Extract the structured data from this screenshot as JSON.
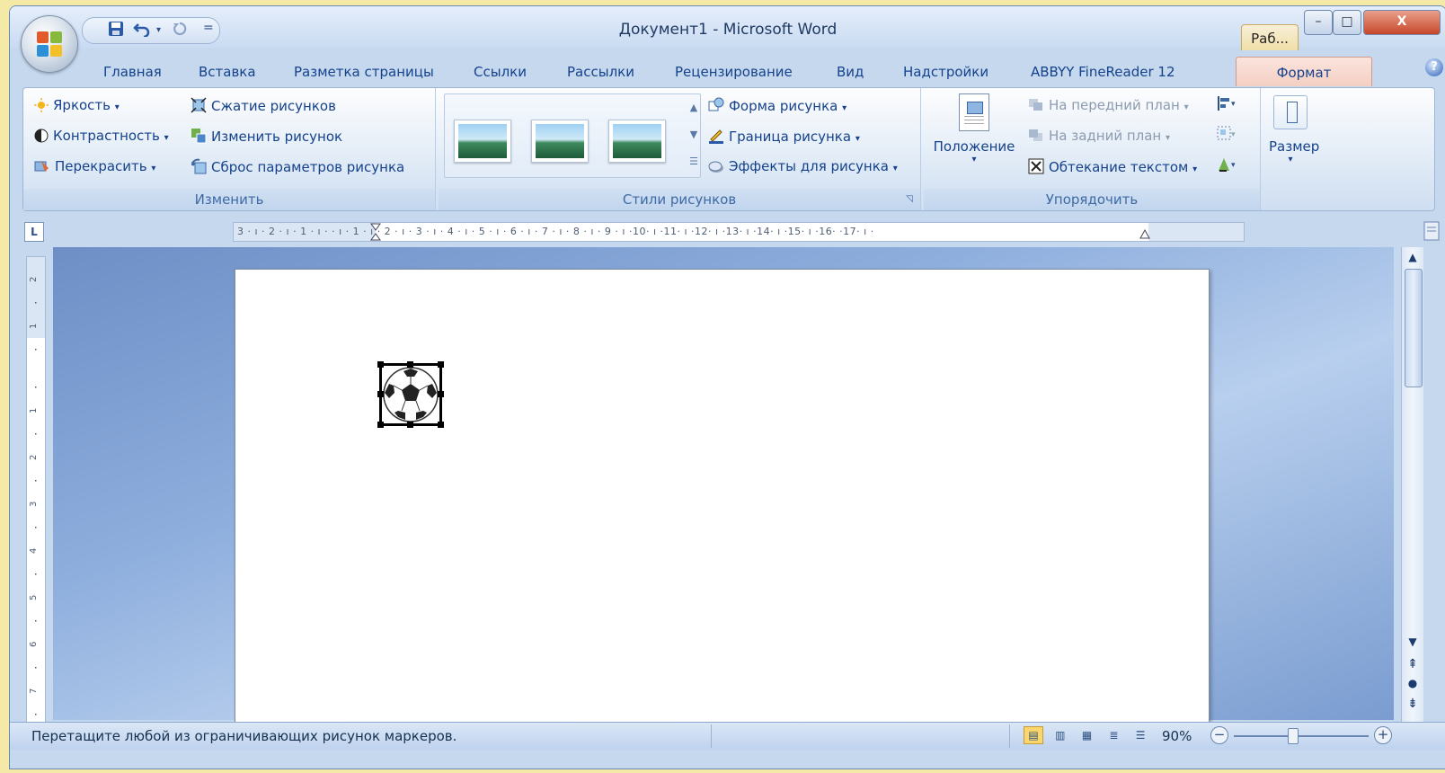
{
  "window": {
    "title": "Документ1 - Microsoft Word",
    "right_tab": "Раб...",
    "controls": {
      "minimize": "–",
      "maximize": "□",
      "close": "X"
    }
  },
  "quick_access": {
    "save_icon": "save-icon",
    "undo_icon": "undo-icon",
    "redo_icon": "redo-icon",
    "customize": "="
  },
  "tabs": [
    {
      "label": "Главная"
    },
    {
      "label": "Вставка"
    },
    {
      "label": "Разметка страницы"
    },
    {
      "label": "Ссылки"
    },
    {
      "label": "Рассылки"
    },
    {
      "label": "Рецензирование"
    },
    {
      "label": "Вид"
    },
    {
      "label": "Надстройки"
    },
    {
      "label": "ABBYY FineReader 12"
    },
    {
      "label": "Формат",
      "active": true
    }
  ],
  "ribbon": {
    "adjust": {
      "label": "Изменить",
      "brightness": "Яркость",
      "contrast": "Контрастность",
      "recolor": "Перекрасить",
      "compress": "Сжатие рисунков",
      "change": "Изменить рисунок",
      "reset": "Сброс параметров рисунка"
    },
    "styles": {
      "label": "Стили рисунков",
      "shape": "Форма рисунка",
      "border": "Граница рисунка",
      "effects": "Эффекты для рисунка"
    },
    "arrange": {
      "label": "Упорядочить",
      "position": "Положение",
      "bring_front": "На передний план",
      "send_back": "На задний план",
      "wrap": "Обтекание текстом"
    },
    "size": {
      "label": "Размер"
    }
  },
  "ruler": {
    "corner": "L",
    "horizontal": "3 · ı · 2 · ı · 1 · ı ·   · ı · 1 · ı · 2 · ı · 3 · ı · 4 · ı · 5 · ı · 6 · ı · 7 · ı · 8 · ı · 9 · ı ·10· ı ·11· ı ·12· ı ·13· ı ·14· ı ·15· ı ·16·   ·17· ı ·"
  },
  "status": {
    "message": "Перетащите любой из ограничивающих рисунок маркеров.",
    "zoom": "90%",
    "zoom_minus": "−",
    "zoom_plus": "+",
    "active_view": "print-layout"
  },
  "colors": {
    "accent": "#15428b",
    "format_tab": "#f4cfc3",
    "desktop": "#f5e9a8"
  }
}
